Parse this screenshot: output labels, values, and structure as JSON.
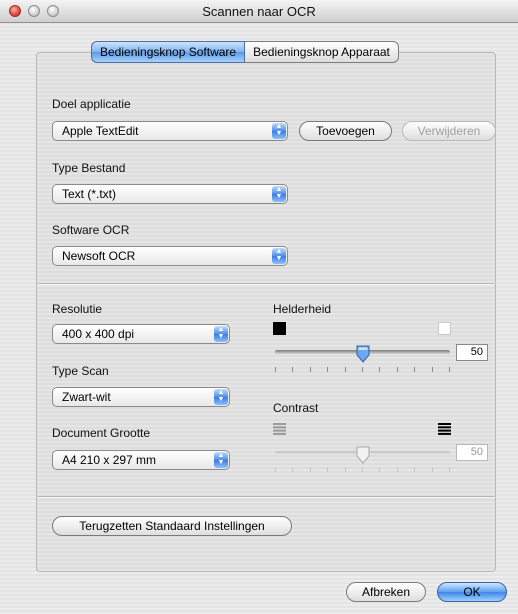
{
  "window": {
    "title": "Scannen naar OCR"
  },
  "tabs": [
    {
      "label": "Bedieningsknop Software",
      "active": true
    },
    {
      "label": "Bedieningsknop Apparaat",
      "active": false
    }
  ],
  "target_app": {
    "label": "Doel applicatie",
    "value": "Apple TextEdit",
    "add_button": "Toevoegen",
    "remove_button": "Verwijderen"
  },
  "file_type": {
    "label": "Type Bestand",
    "value": "Text (*.txt)"
  },
  "ocr_software": {
    "label": "Software OCR",
    "value": "Newsoft OCR"
  },
  "resolution": {
    "label": "Resolutie",
    "value": "400 x 400 dpi"
  },
  "scan_type": {
    "label": "Type Scan",
    "value": "Zwart-wit"
  },
  "document_size": {
    "label": "Document Grootte",
    "value": "A4 210 x 297 mm"
  },
  "brightness": {
    "label": "Helderheid",
    "value": "50",
    "fraction": 0.5,
    "enabled": true
  },
  "contrast": {
    "label": "Contrast",
    "value": "50",
    "fraction": 0.5,
    "enabled": false
  },
  "reset_button": "Terugzetten Standaard Instellingen",
  "footer": {
    "cancel_button": "Afbreken",
    "ok_button": "OK"
  },
  "colors": {
    "accent": "#4f8ee6",
    "swatch_dark": "#000000",
    "swatch_light": "#ffffff"
  }
}
